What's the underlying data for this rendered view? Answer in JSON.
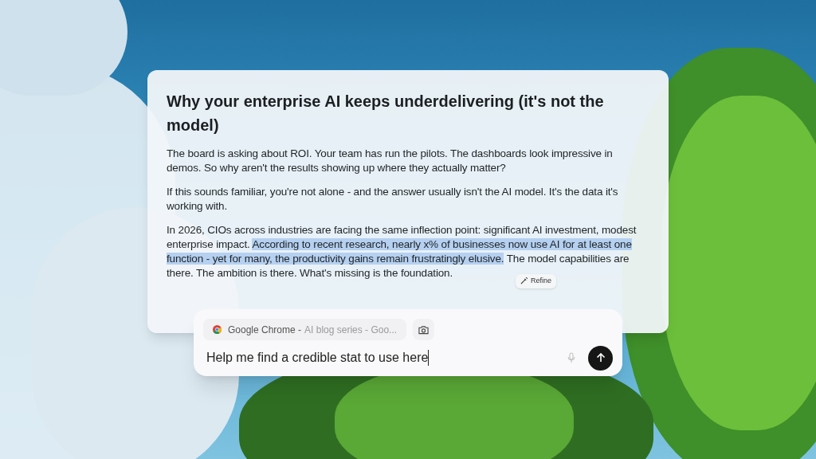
{
  "document": {
    "title": "Why your enterprise AI keeps underdelivering (it's not the model)",
    "paragraphs": [
      {
        "segments": [
          {
            "text": "The board is asking about ROI. Your team has run the pilots. The dashboards look impressive in demos. So why aren't the results showing up where they actually matter?",
            "highlighted": false
          }
        ]
      },
      {
        "segments": [
          {
            "text": "If this sounds familiar, you're not alone - and the answer usually isn't the AI model. It's the data it's working with.",
            "highlighted": false
          }
        ]
      },
      {
        "segments": [
          {
            "text": "In 2026, CIOs across industries are facing the same inflection point: significant AI investment, modest enterprise impact. ",
            "highlighted": false
          },
          {
            "text": "According to recent research, nearly x% of businesses now use AI for at least one function - yet for many, the productivity gains remain frustratingly elusive.",
            "highlighted": true
          },
          {
            "text": " The model capabilities are there. The ambition is there. What's missing is the foundation.",
            "highlighted": false
          }
        ]
      }
    ],
    "refine_button": "Refine"
  },
  "prompt": {
    "context": {
      "app": "Google Chrome -",
      "title": "AI blog series - Goo..."
    },
    "value": "Help me find a credible stat to use here"
  }
}
